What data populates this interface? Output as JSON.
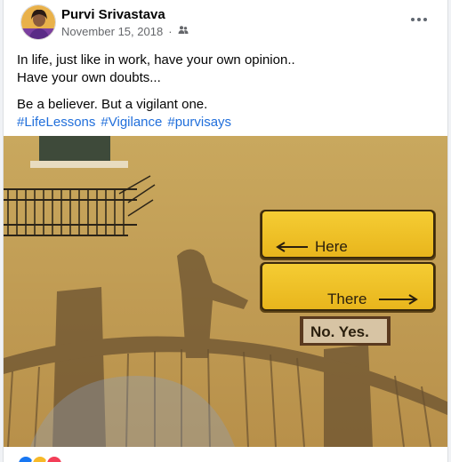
{
  "post": {
    "author": "Purvi Srivastava",
    "date": "November 15, 2018",
    "separator": "·",
    "audience_icon": "friends-icon",
    "lines": [
      "In life, just like in work, have your own opinion..",
      "Have your own doubts...",
      "Be a believer. But a vigilant one."
    ],
    "hashtags": [
      "#LifeLessons",
      "#Vigilance",
      "#purvisays"
    ]
  },
  "photo": {
    "sign_here": "Here",
    "sign_there": "There",
    "sign_plaque": "No. Yes."
  },
  "colors": {
    "link": "#216fdb",
    "wall": "#c9a55a",
    "sign": "#f2c428"
  },
  "reactions": [
    "like-icon",
    "haha-icon",
    "love-icon"
  ]
}
